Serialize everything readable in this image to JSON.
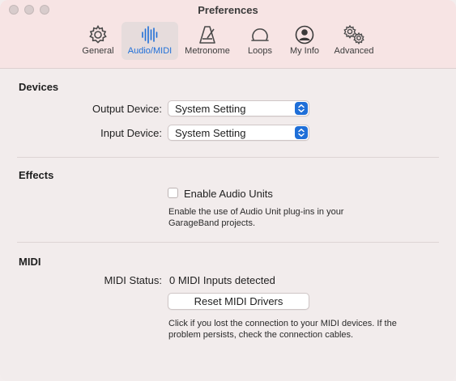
{
  "window": {
    "title": "Preferences"
  },
  "tabs": [
    {
      "label": "General",
      "icon": "gear-icon"
    },
    {
      "label": "Audio/MIDI",
      "icon": "waveform-icon",
      "active": true
    },
    {
      "label": "Metronome",
      "icon": "metronome-icon"
    },
    {
      "label": "Loops",
      "icon": "loop-icon"
    },
    {
      "label": "My Info",
      "icon": "person-icon"
    },
    {
      "label": "Advanced",
      "icon": "gears-icon"
    }
  ],
  "devices": {
    "heading": "Devices",
    "output_label": "Output Device:",
    "output_value": "System Setting",
    "input_label": "Input Device:",
    "input_value": "System Setting"
  },
  "effects": {
    "heading": "Effects",
    "checkbox_label": "Enable Audio Units",
    "checkbox_checked": false,
    "description_line1": "Enable the use of Audio Unit plug-ins in your",
    "description_line2": "GarageBand projects."
  },
  "midi": {
    "heading": "MIDI",
    "status_label": "MIDI Status:",
    "status_value": "0 MIDI Inputs detected",
    "reset_button": "Reset MIDI Drivers",
    "description_line1": "Click if you lost the connection to your MIDI devices. If the",
    "description_line2": "problem persists, check the connection cables."
  },
  "colors": {
    "accent": "#1f6fd8",
    "titlebar": "#f7e4e4",
    "background": "#f2ecec"
  }
}
